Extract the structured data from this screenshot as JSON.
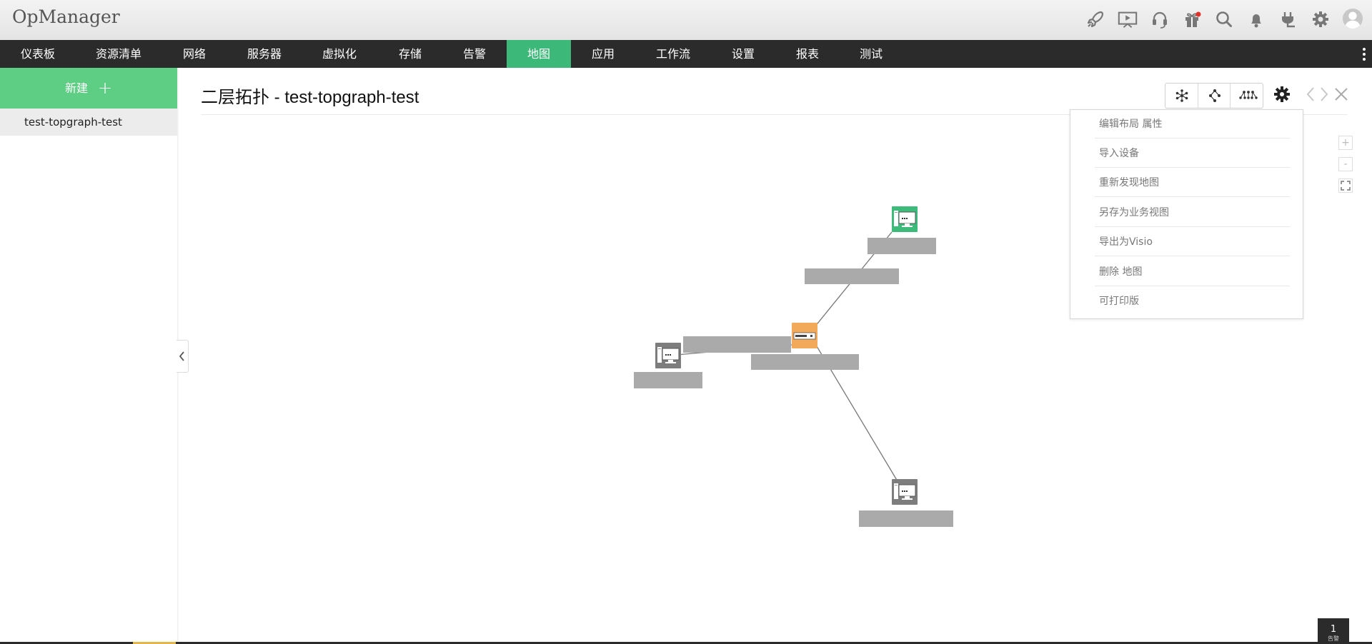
{
  "app": {
    "title": "OpManager"
  },
  "top_icons": [
    "rocket-icon",
    "presentation-icon",
    "headset-icon",
    "gift-icon",
    "search-icon",
    "bell-icon",
    "plug-icon",
    "gear-icon",
    "user-avatar-icon"
  ],
  "nav": {
    "items": [
      {
        "label": "仪表板"
      },
      {
        "label": "资源清单"
      },
      {
        "label": "网络"
      },
      {
        "label": "服务器"
      },
      {
        "label": "虚拟化"
      },
      {
        "label": "存储"
      },
      {
        "label": "告警"
      },
      {
        "label": "地图"
      },
      {
        "label": "应用"
      },
      {
        "label": "工作流"
      },
      {
        "label": "设置"
      },
      {
        "label": "报表"
      },
      {
        "label": "测试"
      }
    ],
    "active": "地图"
  },
  "sidebar": {
    "new_label": "新建",
    "new_icon": "plus-icon",
    "items": [
      {
        "label": "test-topgraph-test"
      }
    ]
  },
  "content": {
    "title": "二层拓扑 - test-topgraph-test",
    "view_buttons": [
      "radial-layout-icon",
      "tree-layout-icon",
      "hierarchical-layout-icon"
    ]
  },
  "settings_menu": {
    "items": [
      {
        "label": "编辑布局 属性"
      },
      {
        "label": "导入设备"
      },
      {
        "label": "重新发现地图"
      },
      {
        "label": "另存为业务视图"
      },
      {
        "label": "导出为Visio"
      },
      {
        "label": "删除 地图"
      },
      {
        "label": "可打印版"
      }
    ]
  },
  "zoom": {
    "in_label": "+",
    "out_label": "-"
  },
  "map": {
    "nodes": [
      {
        "type": "desktop",
        "status": "clear",
        "status_color": "#3dbb7a"
      },
      {
        "type": "switch",
        "status": "attention",
        "status_color": "#f2a95a"
      },
      {
        "type": "desktop",
        "status": "unmanaged",
        "status_color": "#7d7d7d"
      },
      {
        "type": "desktop",
        "status": "unmanaged",
        "status_color": "#7d7d7d"
      }
    ]
  },
  "footer": {
    "alarm_count": "1",
    "alarm_label": "告警"
  },
  "colors": {
    "accent": "#3cb878",
    "nav_bg": "#2b2b2b",
    "new_button": "#5dce83"
  }
}
